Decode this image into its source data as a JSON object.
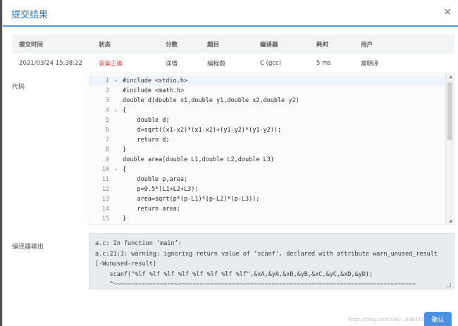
{
  "dialog": {
    "title": "提交结果",
    "close": "×",
    "confirm": "确认",
    "watermark": "https://blog.csdn.net/...53811556"
  },
  "table": {
    "headers": [
      "提交时间",
      "状态",
      "分数",
      "题目",
      "编译器",
      "耗时",
      "用户"
    ],
    "row": [
      "2021/03/24 15:38:22",
      "答案正确",
      "详情",
      "编程题",
      "C (gcc)",
      "5 ms",
      "雷明泽"
    ]
  },
  "labels": {
    "code": "代码",
    "compiler_output": "编译器输出"
  },
  "code": {
    "line_numbers": [
      "1",
      "2",
      "3",
      "4",
      "5",
      "6",
      "7",
      "8",
      "9",
      "10",
      "11",
      "12",
      "13",
      "14",
      "15"
    ],
    "fold_markers": [
      "▾",
      "",
      "",
      "▾",
      "",
      "",
      "",
      "",
      "",
      "▾",
      "",
      "",
      "",
      "",
      ""
    ],
    "lines": [
      "#include <stdio.h>",
      "#include <math.h>",
      "double d(double x1,double y1,double x2,double y2)",
      "{",
      "    double d;",
      "    d=sqrt((x1-x2)*(x1-x2)+(y1-y2)*(y1-y2));",
      "    return d;",
      "}",
      "double area(double L1,double L2,double L3)",
      "{",
      "    double p,area;",
      "    p=0.5*(L1+L2+L3);",
      "    area=sqrt(p*(p-L1)*(p-L2)*(p-L3));",
      "    return area;",
      "}"
    ]
  },
  "compiler_output": "a.c: In function ‘main’:\na.c:21:3: warning: ignoring return value of ‘scanf’, declared with attribute warn_unused_result\n[-Wunused-result]\n    scanf(\"%lf %lf %lf %lf %lf %lf %lf %lf\",&xA,&yA,&xB,&yB,&xC,&yC,&xD,&yD);\n    ^~~~~~~~~~~~~~~~~~~~~~~~~~~~~~~~~~~~~~~~~~~~~~~~~~~~~~~~~~~~~~~~~~~~~~~~~~~~~~~~~~~~~",
  "colors": {
    "accent": "#2f6db3",
    "success_status": "#e04747"
  }
}
